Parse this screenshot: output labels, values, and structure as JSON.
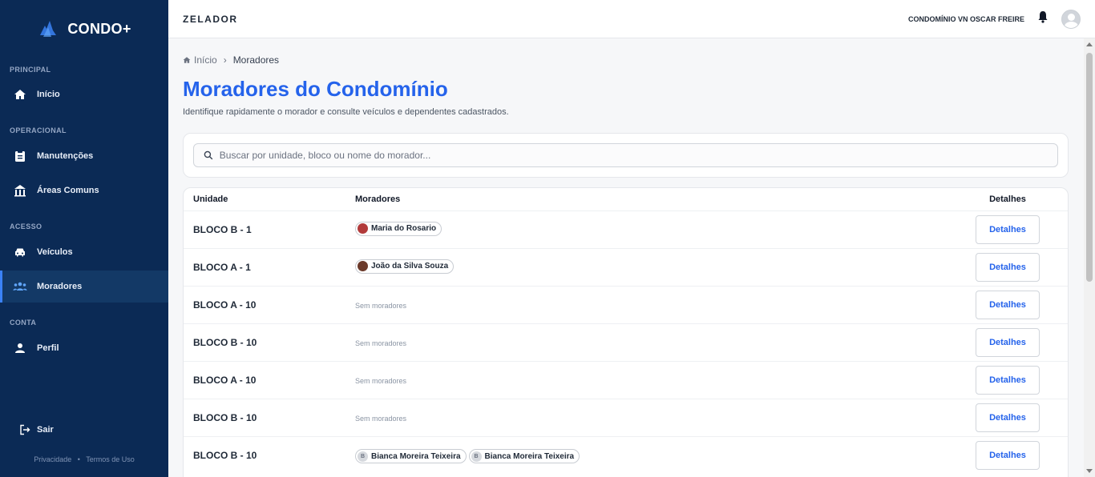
{
  "app": {
    "brand": "CONDO+"
  },
  "sidebar": {
    "sections": [
      {
        "label": "PRINCIPAL"
      },
      {
        "label": "OPERACIONAL"
      },
      {
        "label": "ACESSO"
      },
      {
        "label": "CONTA"
      }
    ],
    "items": {
      "inicio": {
        "label": "Início",
        "icon": "home-icon"
      },
      "manutencoes": {
        "label": "Manutenções",
        "icon": "clipboard-icon"
      },
      "areas": {
        "label": "Áreas Comuns",
        "icon": "building-icon"
      },
      "veiculos": {
        "label": "Veículos",
        "icon": "car-icon"
      },
      "moradores": {
        "label": "Moradores",
        "icon": "people-icon",
        "active": true
      },
      "perfil": {
        "label": "Perfil",
        "icon": "person-icon"
      }
    },
    "logout": "Sair",
    "footer": {
      "privacy": "Privacidade",
      "sep": "•",
      "terms": "Termos de Uso"
    }
  },
  "header": {
    "role": "ZELADOR",
    "condo": "CONDOMÍNIO VN OSCAR FREIRE"
  },
  "breadcrumb": {
    "home": "Início",
    "sep": "›",
    "current": "Moradores"
  },
  "page": {
    "title": "Moradores do Condomínio",
    "subtitle": "Identifique rapidamente o morador e consulte veículos e dependentes cadastrados."
  },
  "search": {
    "placeholder": "Buscar por unidade, bloco ou nome do morador..."
  },
  "table": {
    "headers": {
      "unit": "Unidade",
      "residents": "Moradores",
      "details": "Detalhes"
    },
    "detail_label": "Detalhes",
    "empty_label": "Sem moradores",
    "rows": [
      {
        "unit": "BLOCO B - 1",
        "residents": [
          "Maria do Rosario"
        ]
      },
      {
        "unit": "BLOCO A - 1",
        "residents": [
          "João da Silva Souza"
        ]
      },
      {
        "unit": "BLOCO A - 10",
        "residents": []
      },
      {
        "unit": "BLOCO B - 10",
        "residents": []
      },
      {
        "unit": "BLOCO A - 10",
        "residents": []
      },
      {
        "unit": "BLOCO B - 10",
        "residents": []
      },
      {
        "unit": "BLOCO B - 10",
        "residents": [
          "Bianca Moreira Teixeira",
          "Bianca Moreira Teixeira"
        ]
      }
    ],
    "initial_letter": "B"
  },
  "colors": {
    "sidebar": "#0b2a55",
    "accent": "#2563eb",
    "active": "#133966"
  }
}
